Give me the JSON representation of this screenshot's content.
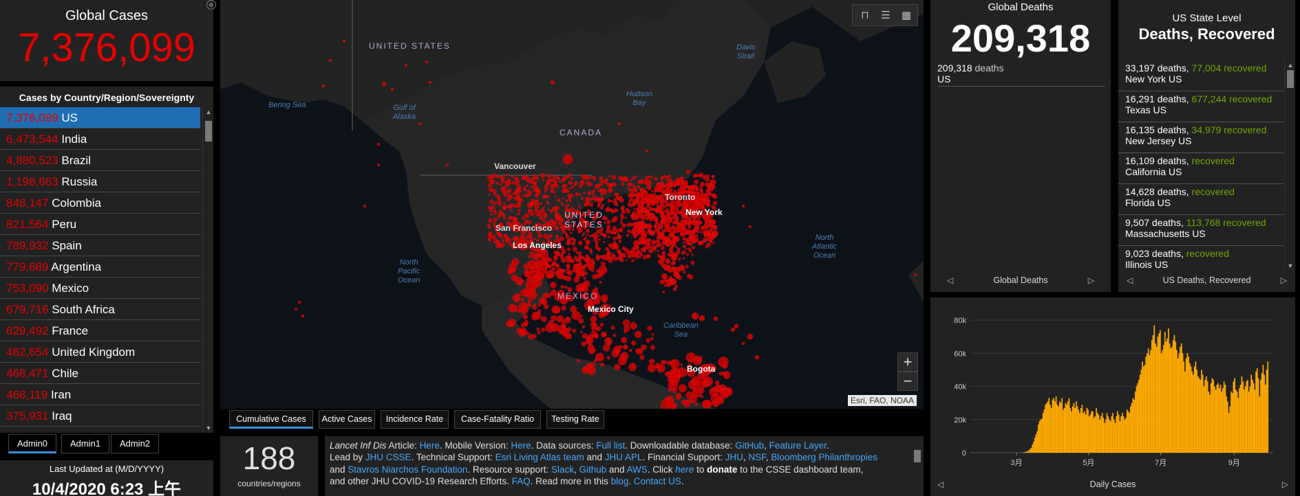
{
  "global_cases": {
    "label": "Global Cases",
    "value": "7,376,099"
  },
  "country_list": {
    "header": "Cases by Country/Region/Sovereignty",
    "rows": [
      {
        "num": "7,376,099",
        "name": "US"
      },
      {
        "num": "6,473,544",
        "name": "India"
      },
      {
        "num": "4,880,523",
        "name": "Brazil"
      },
      {
        "num": "1,198,663",
        "name": "Russia"
      },
      {
        "num": "848,147",
        "name": "Colombia"
      },
      {
        "num": "821,564",
        "name": "Peru"
      },
      {
        "num": "789,932",
        "name": "Spain"
      },
      {
        "num": "779,689",
        "name": "Argentina"
      },
      {
        "num": "753,090",
        "name": "Mexico"
      },
      {
        "num": "679,716",
        "name": "South Africa"
      },
      {
        "num": "629,492",
        "name": "France"
      },
      {
        "num": "482,654",
        "name": "United Kingdom"
      },
      {
        "num": "468,471",
        "name": "Chile"
      },
      {
        "num": "468,119",
        "name": "Iran"
      },
      {
        "num": "375,931",
        "name": "Iraq"
      }
    ]
  },
  "admin_tabs": [
    "Admin0",
    "Admin1",
    "Admin2"
  ],
  "last_updated": {
    "label": "Last Updated at (M/D/YYYY)",
    "value": "10/4/2020 6:23 上午"
  },
  "map": {
    "labels": {
      "united_states_top": "UNITED\nSTATES",
      "bering_sea": "Bering Sea",
      "gulf_of_alaska": "Gulf of\nAlaska",
      "canada": "CANADA",
      "hudson_bay": "Hudson\nBay",
      "davis_strait": "Davis\nStrait",
      "vancouver": "Vancouver",
      "toronto": "Toronto",
      "new_york": "New York",
      "san_francisco": "San Francisco",
      "los_angeles": "Los Angeles",
      "united_states_mid": "UNITED\nSTATES",
      "north_pacific": "North\nPacific\nOcean",
      "north_atlantic": "North\nAtlantic\nOcean",
      "mexico": "MEXICO",
      "mexico_city": "Mexico City",
      "caribbean_sea": "Caribbean\nSea",
      "bogota": "Bogota"
    },
    "zoom_in": "+",
    "zoom_out": "−",
    "attribution": "Esri, FAO, NOAA"
  },
  "map_tabs": [
    "Cumulative Cases",
    "Active Cases",
    "Incidence Rate",
    "Case-Fatality Ratio",
    "Testing Rate"
  ],
  "countries_count": {
    "value": "188",
    "label": "countries/regions"
  },
  "info": {
    "lancet": "Lancet Inf Dis",
    "t1": " Article: ",
    "here1": "Here",
    "t2": ". Mobile Version: ",
    "here2": "Here",
    "t3": ". Data sources: ",
    "full_list": "Full list",
    "t4": ". Downloadable database: ",
    "github": "GitHub",
    "t5": ", ",
    "feature_layer": "Feature Layer",
    "t6": ".",
    "t7": "Lead by ",
    "jhu_csse": "JHU CSSE",
    "t8": ". Technical Support: ",
    "esri_living": "Esri Living Atlas team",
    "t9": " and ",
    "jhu_apl": "JHU APL",
    "t10": ". Financial Support: ",
    "jhu": "JHU",
    "t11": ", ",
    "nsf": "NSF",
    "t12": ", ",
    "bloomberg": "Bloomberg Philanthropies",
    "t13": "and ",
    "stavros": "Stavros Niarchos Foundation",
    "t14": ". Resource support: ",
    "slack": "Slack",
    "t15": ", ",
    "github2": "Github",
    "t16": " and ",
    "aws": "AWS",
    "t17": ". Click ",
    "here3": "here",
    "t18": " to ",
    "donate": "donate",
    "t19": " to the CSSE dashboard team,",
    "t20": "and other JHU COVID-19 Research Efforts. ",
    "faq": "FAQ",
    "t21": ". Read more in this ",
    "blog": "blog",
    "t22": ". ",
    "contact": "Contact US",
    "t23": "."
  },
  "global_deaths": {
    "label": "Global Deaths",
    "value": "209,318",
    "entry_num": "209,318",
    "entry_word": " deaths",
    "entry_place": "US",
    "footer": "Global Deaths"
  },
  "us_state": {
    "label": "US State Level",
    "title": "Deaths, Recovered",
    "rows": [
      {
        "deaths": "33,197 deaths,",
        "recovered": "77,004",
        "rec_word": "recovered",
        "place": "New York US"
      },
      {
        "deaths": "16,291 deaths,",
        "recovered": "677,244",
        "rec_word": "recovered",
        "place": "Texas US"
      },
      {
        "deaths": "16,135 deaths,",
        "recovered": "34,979",
        "rec_word": "recovered",
        "place": "New Jersey US"
      },
      {
        "deaths": "16,109 deaths,",
        "recovered": "",
        "rec_word": "recovered",
        "place": "California US"
      },
      {
        "deaths": "14,628 deaths,",
        "recovered": "",
        "rec_word": "recovered",
        "place": "Florida US"
      },
      {
        "deaths": "9,507 deaths,",
        "recovered": "113,768",
        "rec_word": "recovered",
        "place": "Massachusetts US"
      },
      {
        "deaths": "9,023 deaths,",
        "recovered": "",
        "rec_word": "recovered",
        "place": "Illinois US"
      }
    ],
    "footer": "US Deaths, Recovered"
  },
  "colors": {
    "accent": "#e60000",
    "recovered": "#70a800",
    "link": "#45a8ff",
    "bars": "#ffaa00",
    "selected": "#1f6eb4"
  },
  "chart_data": {
    "type": "bar",
    "title": "",
    "footer": "Daily Cases",
    "x_start": "2020-01-22",
    "x_end": "2020-10-03",
    "xticks": [
      {
        "label": "3月",
        "date": "2020-03-01"
      },
      {
        "label": "5月",
        "date": "2020-05-01"
      },
      {
        "label": "7月",
        "date": "2020-07-01"
      },
      {
        "label": "9月",
        "date": "2020-09-01"
      }
    ],
    "yticks": [
      "0",
      "20k",
      "40k",
      "60k",
      "80k"
    ],
    "ylim": [
      0,
      80000
    ],
    "values": [
      0,
      0,
      0,
      0,
      0,
      0,
      0,
      0,
      0,
      0,
      0,
      0,
      0,
      0,
      0,
      0,
      0,
      0,
      0,
      0,
      0,
      0,
      0,
      0,
      0,
      0,
      0,
      0,
      0,
      0,
      0,
      0,
      0,
      0,
      0,
      0,
      0,
      0,
      0,
      0,
      0,
      50,
      60,
      120,
      200,
      300,
      500,
      700,
      1000,
      1500,
      2200,
      3000,
      5000,
      6500,
      9000,
      11000,
      13000,
      17000,
      19000,
      20000,
      20500,
      24000,
      26000,
      29000,
      30000,
      31000,
      33000,
      29000,
      27000,
      32000,
      33000,
      31000,
      34000,
      29000,
      28000,
      31000,
      30000,
      33000,
      26000,
      27000,
      30000,
      29000,
      31000,
      33000,
      27000,
      25000,
      28000,
      30000,
      27000,
      31000,
      28000,
      26000,
      24000,
      27000,
      29000,
      24000,
      25000,
      23000,
      27000,
      26000,
      22000,
      23000,
      25000,
      25000,
      21000,
      22000,
      27000,
      24000,
      23000,
      20000,
      22000,
      24000,
      21000,
      18000,
      20000,
      24000,
      22000,
      20000,
      19000,
      22000,
      24000,
      20000,
      18000,
      22000,
      25000,
      23000,
      19000,
      22000,
      24000,
      22000,
      20000,
      21000,
      26000,
      25000,
      24000,
      28000,
      30000,
      33000,
      32000,
      37000,
      40000,
      42000,
      44000,
      47000,
      50000,
      55000,
      52000,
      53000,
      58000,
      60000,
      63000,
      59000,
      62000,
      68000,
      71000,
      77000,
      66000,
      64000,
      70000,
      72000,
      74000,
      60000,
      62000,
      65000,
      73000,
      67000,
      69000,
      75000,
      66000,
      63000,
      64000,
      68000,
      71000,
      67000,
      62000,
      57000,
      60000,
      64000,
      66000,
      60000,
      55000,
      49000,
      57000,
      60000,
      58000,
      54000,
      52000,
      49000,
      47000,
      52000,
      55000,
      50000,
      46000,
      45000,
      44000,
      50000,
      47000,
      40000,
      44000,
      46000,
      43000,
      37000,
      35000,
      42000,
      45000,
      44000,
      40000,
      38000,
      41000,
      42000,
      39000,
      41000,
      37000,
      39000,
      43000,
      41000,
      34000,
      31000,
      24000,
      28000,
      37000,
      36000,
      43000,
      45000,
      38000,
      37000,
      33000,
      39000,
      41000,
      46000,
      43000,
      38000,
      40000,
      43000,
      44000,
      37000,
      40000,
      47000,
      44000,
      42000,
      38000,
      49000,
      51000,
      45000,
      34000,
      44000,
      48000,
      53000,
      47000,
      41000,
      50000,
      55000
    ]
  }
}
